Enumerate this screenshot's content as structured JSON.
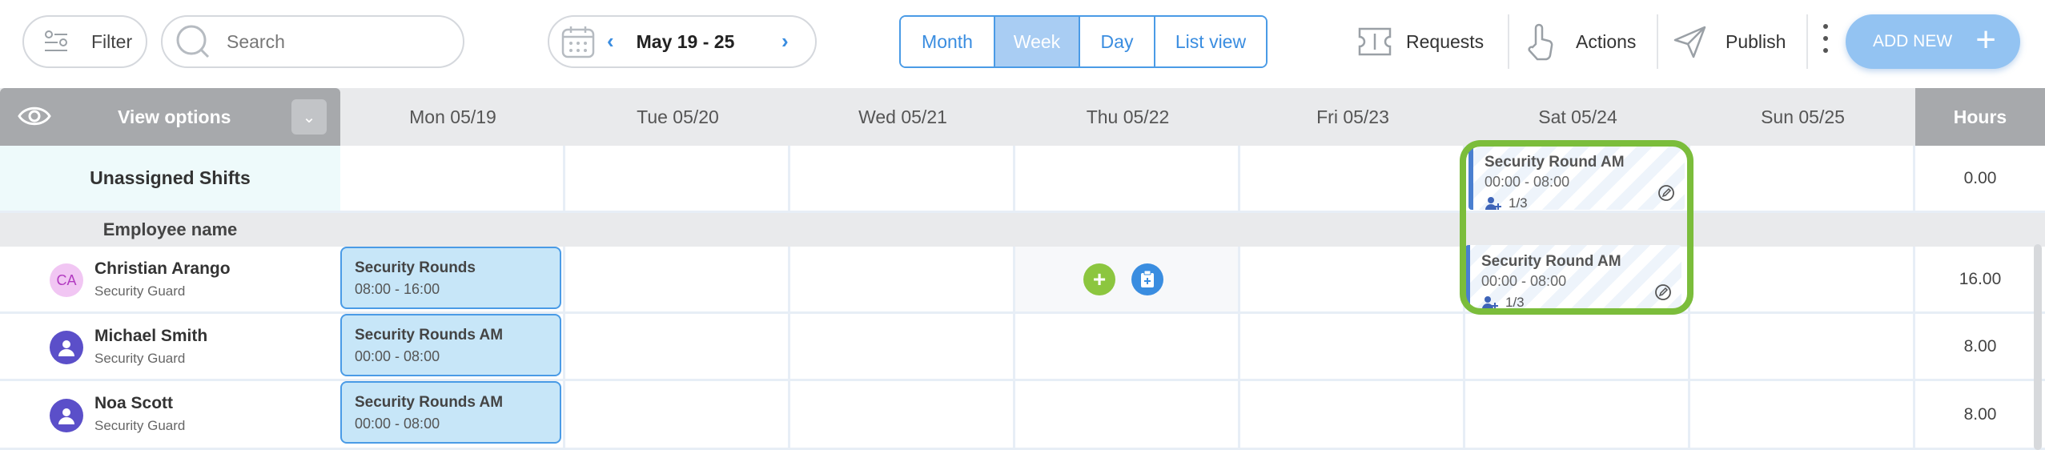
{
  "toolbar": {
    "filter_label": "Filter",
    "search_placeholder": "Search",
    "date_range": "May 19 - 25",
    "views": [
      {
        "label": "Month",
        "active": false
      },
      {
        "label": "Week",
        "active": true
      },
      {
        "label": "Day",
        "active": false
      },
      {
        "label": "List view",
        "active": false
      }
    ],
    "requests_label": "Requests",
    "actions_label": "Actions",
    "publish_label": "Publish",
    "add_new_label": "ADD NEW"
  },
  "grid": {
    "view_options_label": "View options",
    "days": [
      "Mon 05/19",
      "Tue 05/20",
      "Wed 05/21",
      "Thu 05/22",
      "Fri 05/23",
      "Sat 05/24",
      "Sun 05/25"
    ],
    "hours_label": "Hours",
    "unassigned_label": "Unassigned Shifts",
    "unassigned_hours": "0.00",
    "employee_name_label": "Employee name",
    "open_shifts": [
      {
        "title": "Security Round AM",
        "time": "00:00 - 08:00",
        "count": "1/3"
      },
      {
        "title": "Security Round AM",
        "time": "00:00 - 08:00",
        "count": "1/3"
      }
    ],
    "employees": [
      {
        "name": "Christian Arango",
        "role": "Security Guard",
        "initials": "CA",
        "hours": "16.00",
        "shift_title": "Security Rounds",
        "shift_time": "08:00 - 16:00"
      },
      {
        "name": "Michael Smith",
        "role": "Security Guard",
        "initials": "",
        "hours": "8.00",
        "shift_title": "Security Rounds AM",
        "shift_time": "00:00 - 08:00"
      },
      {
        "name": "Noa Scott",
        "role": "Security Guard",
        "initials": "",
        "hours": "8.00",
        "shift_title": "Security Rounds AM",
        "shift_time": "00:00 - 08:00"
      }
    ]
  },
  "colors": {
    "accent": "#4a9be6",
    "highlight": "#7bbd3b",
    "header_gray": "#a7a9ac"
  }
}
